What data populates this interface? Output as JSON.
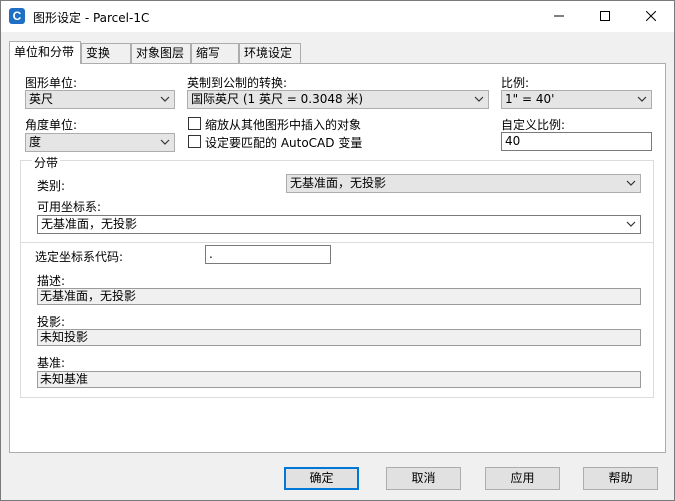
{
  "window": {
    "title": "图形设定 - Parcel-1C",
    "icon_letter": "C"
  },
  "tabs": [
    {
      "label": "单位和分带",
      "active": true
    },
    {
      "label": "变换",
      "active": false
    },
    {
      "label": "对象图层",
      "active": false
    },
    {
      "label": "缩写",
      "active": false
    },
    {
      "label": "环境设定",
      "active": false
    }
  ],
  "units": {
    "drawing_unit_label": "图形单位:",
    "drawing_unit_value": "英尺",
    "angle_unit_label": "角度单位:",
    "angle_unit_value": "度",
    "conversion_label": "英制到公制的转换:",
    "conversion_value": "国际英尺 (1 英尺 = 0.3048 米)",
    "scale_label": "比例:",
    "scale_value": "1\" = 40'",
    "custom_scale_label": "自定义比例:",
    "custom_scale_value": "40",
    "scale_objects_label": "缩放从其他图形中插入的对象",
    "set_autocad_vars_label": "设定要匹配的 AutoCAD 变量"
  },
  "zone": {
    "group_title": "分带",
    "category_label": "类别:",
    "category_value": "无基准面，无投影",
    "available_cs_label": "可用坐标系:",
    "available_cs_value": "无基准面，无投影",
    "selected_code_label": "选定坐标系代码:",
    "selected_code_value": ".",
    "description_label": "描述:",
    "description_value": "无基准面，无投影",
    "projection_label": "投影:",
    "projection_value": "未知投影",
    "datum_label": "基准:",
    "datum_value": "未知基准"
  },
  "buttons": {
    "ok": "确定",
    "cancel": "取消",
    "apply": "应用",
    "help": "帮助"
  }
}
